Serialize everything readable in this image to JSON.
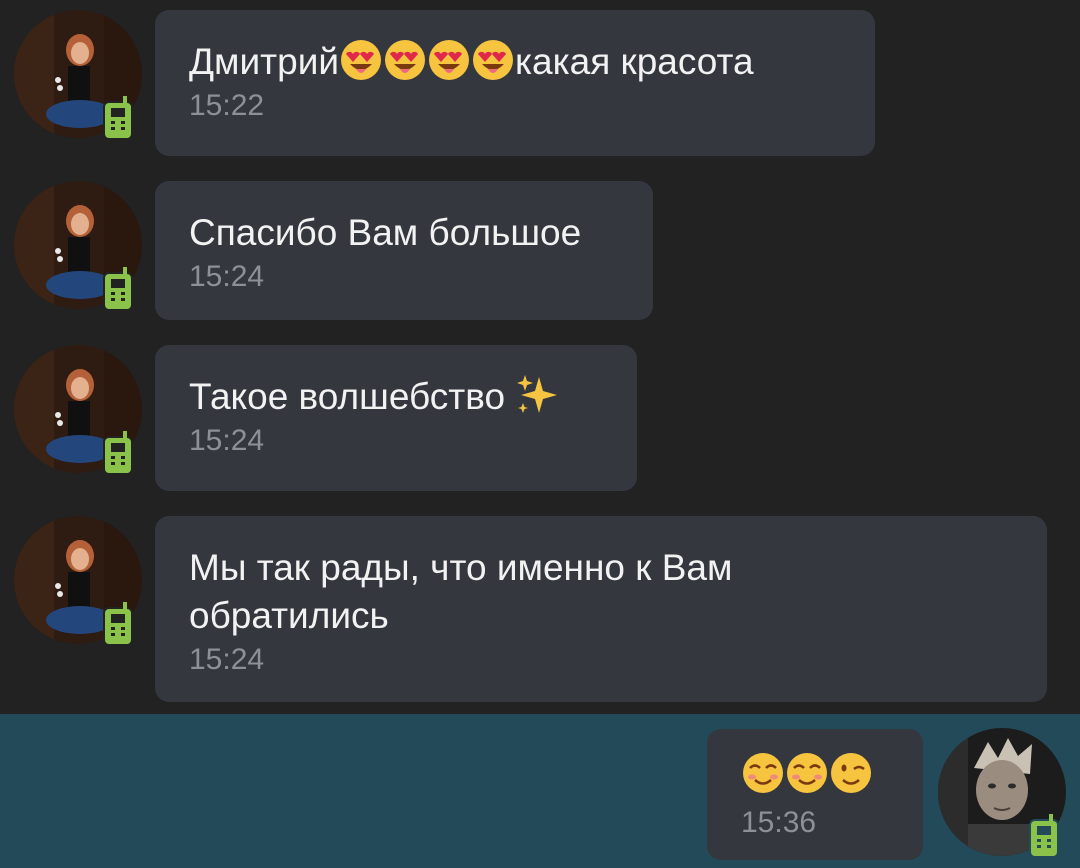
{
  "messages": [
    {
      "sender": "incoming",
      "text_before": "Дмитрий",
      "emojis": [
        "heart-eyes-tongue",
        "heart-eyes-tongue",
        "heart-eyes-tongue",
        "heart-eyes-tongue"
      ],
      "text_after": "какая красота",
      "time": "15:22"
    },
    {
      "sender": "incoming",
      "text": "Спасибо Вам большое",
      "time": "15:24"
    },
    {
      "sender": "incoming",
      "text": "Такое волшебство ",
      "emoji": "sparkles",
      "time": "15:24"
    },
    {
      "sender": "incoming",
      "text_line1": "Мы так рады, что именно к Вам",
      "text_line2": "обратились",
      "time": "15:24"
    },
    {
      "sender": "outgoing",
      "emojis": [
        "smiling-blush",
        "smiling-blush",
        "winking-face"
      ],
      "time": "15:36"
    }
  ],
  "colors": {
    "background": "#222223",
    "bubble": "#35373e",
    "outgoing_band": "#234a58",
    "text": "#f2f2f2",
    "time": "#8d9096",
    "online_badge": "#8bc34a"
  },
  "icons": {
    "online_badge": "mobile-phone-icon",
    "sender_avatar": "woman-avatar",
    "user_avatar": "man-avatar"
  }
}
